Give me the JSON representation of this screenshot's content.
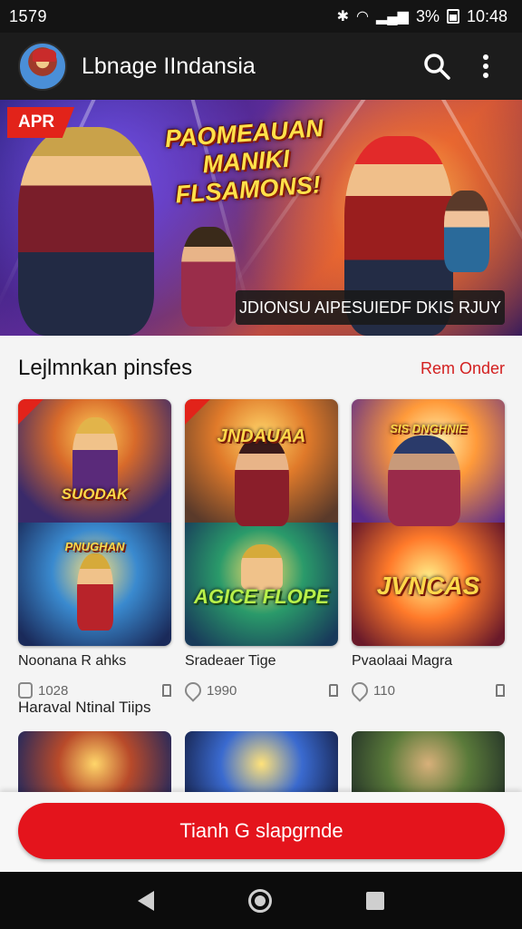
{
  "status_bar": {
    "time_left": "1579",
    "battery": "3%",
    "clock": "10:48"
  },
  "app_bar": {
    "title": "Lbnage IIndansia",
    "search_icon": "search-icon",
    "menu_icon": "more-vert-icon"
  },
  "banner": {
    "badge": "APR",
    "title_lines": [
      "PAOMEAUAN",
      "MANIKI",
      "FLSAMONS!"
    ],
    "caption": "JDIONSU AIPESUIEDF DKIS RJUY"
  },
  "section": {
    "title": "Lejlmnkan pinsfes",
    "link": "Rem Onder"
  },
  "cards": [
    {
      "name": "Noonana R ahks",
      "rating": "1028",
      "label_top": "SUODAK",
      "label_bottom": "PNUGHAN",
      "sub": "Haraval Ntinal Tiips"
    },
    {
      "name": "Sradeaer Tige",
      "rating": "1990",
      "label_top": "JNDAUAA",
      "label_bottom": "AGICE FLOPE"
    },
    {
      "name": "Pvaolaai Magra",
      "rating": "110",
      "label_top": "SIS DNGHNIE",
      "label_bottom": "JVNCAS"
    }
  ],
  "cta": {
    "label": "Tianh G  slapgrnde"
  },
  "colors": {
    "accent": "#e4141c",
    "appbar": "#1c1c1c",
    "statusbar": "#141414"
  }
}
